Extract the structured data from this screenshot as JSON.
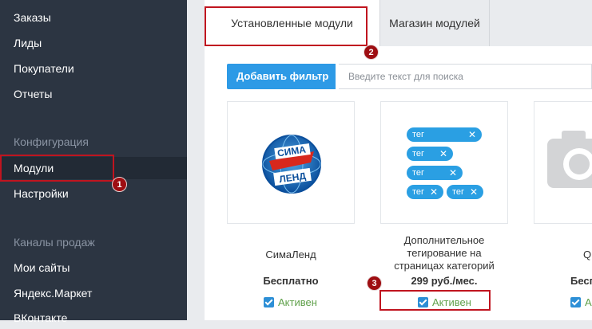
{
  "sidebar": {
    "items_top": [
      "Заказы",
      "Лиды",
      "Покупатели",
      "Отчеты"
    ],
    "section_config": "Конфигурация",
    "items_config": [
      "Модули",
      "Настройки"
    ],
    "section_channels": "Каналы продаж",
    "items_channels": [
      "Мои сайты",
      "Яндекс.Маркет",
      "ВКонтакте"
    ],
    "active": "Модули"
  },
  "tabs": {
    "installed": "Установленные модули",
    "store": "Магазин модулей"
  },
  "filter": {
    "button_label": "Добавить фильтр",
    "search_placeholder": "Введите текст для поиска"
  },
  "modules": [
    {
      "name": "СимаЛенд",
      "price": "Бесплатно",
      "status": "Активен",
      "logo_text_top": "СИМА",
      "logo_text_bottom": "ЛЕНД"
    },
    {
      "name_lines": [
        "Дополнительное",
        "тегирование на",
        "страницах категорий"
      ],
      "price": "299 руб./мес.",
      "status": "Активен",
      "tags": [
        "тег",
        "тег",
        "тег",
        "тег",
        "тег"
      ]
    },
    {
      "name": "QR",
      "price": "Бесп",
      "status": "Актив"
    }
  ],
  "annotations": [
    "1",
    "2",
    "3"
  ],
  "colors": {
    "sidebar_bg": "#2c3542",
    "accent": "#2d9ae6",
    "status_green": "#5fa04a",
    "annotation_red": "#c0141f"
  }
}
